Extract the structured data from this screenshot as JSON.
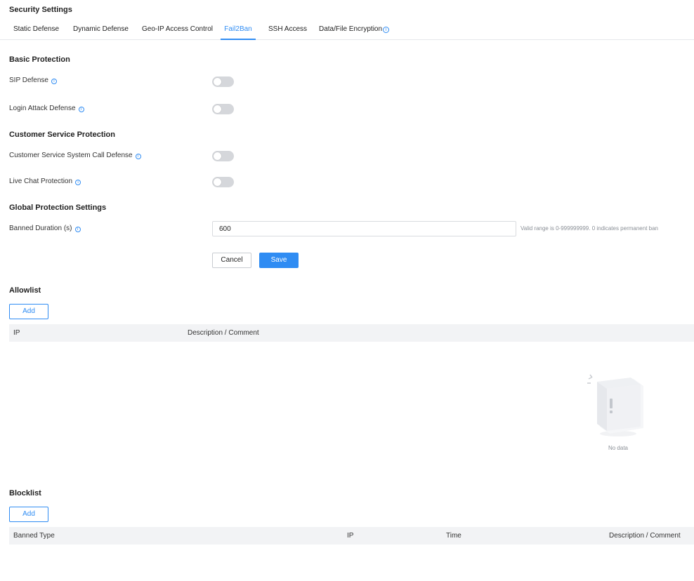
{
  "header": {
    "title": "Security Settings"
  },
  "tabs": [
    {
      "label": "Static Defense"
    },
    {
      "label": "Dynamic Defense"
    },
    {
      "label": "Geo-IP Access Control"
    },
    {
      "label": "Fail2Ban",
      "active": true
    },
    {
      "label": "SSH Access"
    },
    {
      "label": "Data/File Encryption",
      "icon": "info-icon"
    }
  ],
  "basic": {
    "title": "Basic Protection",
    "sip": {
      "label": "SIP Defense",
      "enabled": false
    },
    "login": {
      "label": "Login Attack Defense",
      "enabled": false
    }
  },
  "customer": {
    "title": "Customer Service Protection",
    "call": {
      "label": "Customer Service System Call Defense",
      "enabled": false
    },
    "chat": {
      "label": "Live Chat Protection",
      "enabled": false
    }
  },
  "global": {
    "title": "Global Protection Settings",
    "banned": {
      "label": "Banned Duration (s)",
      "value": "600",
      "hint": "Valid range is 0-999999999. 0 indicates permanent ban"
    }
  },
  "actions": {
    "cancel": "Cancel",
    "save": "Save"
  },
  "allowlist": {
    "title": "Allowlist",
    "add": "Add",
    "columns": [
      "IP",
      "Description / Comment"
    ],
    "empty": "No data"
  },
  "blocklist": {
    "title": "Blocklist",
    "add": "Add",
    "columns": [
      "Banned Type",
      "IP",
      "Time",
      "Description / Comment"
    ]
  },
  "colors": {
    "accent": "#2f8cf3",
    "toggle_off": "#d5d7db",
    "table_header": "#f2f3f5"
  }
}
